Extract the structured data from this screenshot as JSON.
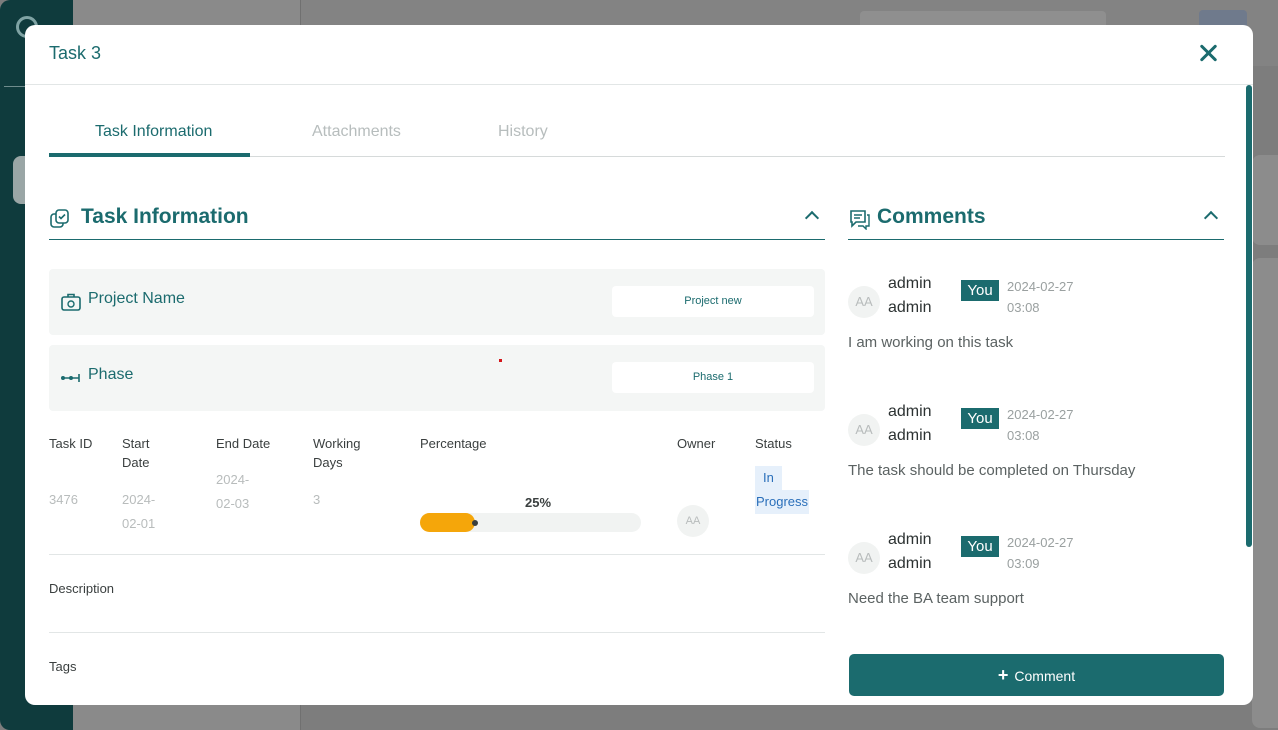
{
  "modal": {
    "title": "Task 3",
    "close_icon": "close-icon"
  },
  "tabs": [
    {
      "label": "Task Information",
      "active": true
    },
    {
      "label": "Attachments",
      "active": false
    },
    {
      "label": "History",
      "active": false
    }
  ],
  "task_info": {
    "section_title": "Task Information",
    "project": {
      "label": "Project Name",
      "value": "Project new",
      "icon": "briefcase-icon"
    },
    "phase": {
      "label": "Phase",
      "value": "Phase 1",
      "icon": "phase-icon"
    },
    "columns": {
      "task_id": "Task ID",
      "start_date": "Start Date",
      "end_date": "End Date",
      "working_days": "Working Days",
      "percentage": "Percentage",
      "owner": "Owner",
      "status": "Status"
    },
    "row": {
      "task_id": "3476",
      "start_date": "2024-02-01",
      "end_date": "2024-02-03",
      "working_days": "3",
      "percentage_label": "25%",
      "percentage_value": 25,
      "owner_initials": "AA",
      "status_l1": "In",
      "status_l2": "Progress"
    },
    "description_label": "Description",
    "tags_label": "Tags"
  },
  "comments": {
    "section_title": "Comments",
    "items": [
      {
        "initials": "AA",
        "name": "admin admin",
        "badge": "You",
        "time": "2024-02-27 03:08",
        "text": "I am working on this task"
      },
      {
        "initials": "AA",
        "name": "admin admin",
        "badge": "You",
        "time": "2024-02-27 03:08",
        "text": "The task should be completed on Thursday"
      },
      {
        "initials": "AA",
        "name": "admin admin",
        "badge": "You",
        "time": "2024-02-27 03:09",
        "text": "Need the BA team support"
      }
    ],
    "add_button_label": "Comment"
  },
  "colors": {
    "accent": "#1b6b6e",
    "progress": "#f5a60a",
    "status_text": "#2a6fba"
  }
}
